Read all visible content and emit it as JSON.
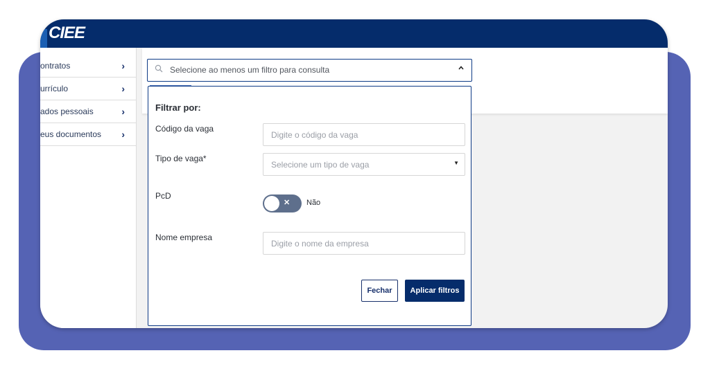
{
  "app": {
    "logo_text": "CIEE"
  },
  "sidebar": {
    "items": [
      {
        "label": "ontratos"
      },
      {
        "label": "urrículo"
      },
      {
        "label": "ados pessoais"
      },
      {
        "label": "eus documentos"
      }
    ],
    "chevron": "›"
  },
  "search": {
    "placeholder": "Selecione ao menos um filtro para consulta",
    "icon": "search-icon",
    "caret": "^"
  },
  "filter": {
    "title": "Filtrar por:",
    "codigo_label": "Código da vaga",
    "codigo_placeholder": "Digite o código da vaga",
    "tipo_label": "Tipo de vaga*",
    "tipo_placeholder": "Selecione um tipo de vaga",
    "pcd_label": "PcD",
    "pcd_value": "Não",
    "pcd_on": false,
    "empresa_label": "Nome empresa",
    "empresa_placeholder": "Digite o nome da empresa",
    "close_label": "Fechar",
    "apply_label": "Aplicar filtros"
  },
  "colors": {
    "brand_navy": "#052c6b",
    "frame_accent": "#5563b4",
    "toggle_off": "#5e6f8c"
  }
}
